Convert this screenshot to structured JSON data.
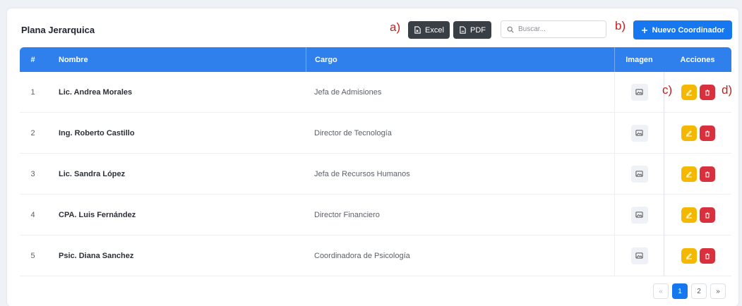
{
  "panel": {
    "title": "Plana Jerarquica"
  },
  "toolbar": {
    "excel_label": "Excel",
    "pdf_label": "PDF",
    "search_placeholder": "Buscar...",
    "new_label": "Nuevo Coordinador"
  },
  "annotations": {
    "a": "a)",
    "b": "b)",
    "c": "c)",
    "d": "d)"
  },
  "table": {
    "headers": {
      "num": "#",
      "name": "Nombre",
      "cargo": "Cargo",
      "image": "Imagen",
      "actions": "Acciones"
    },
    "rows": [
      {
        "num": "1",
        "name": "Lic. Andrea Morales",
        "cargo": "Jefa de Admisiones"
      },
      {
        "num": "2",
        "name": "Ing. Roberto Castillo",
        "cargo": "Director de Tecnología"
      },
      {
        "num": "3",
        "name": "Lic. Sandra López",
        "cargo": "Jefa de Recursos Humanos"
      },
      {
        "num": "4",
        "name": "CPA. Luis Fernández",
        "cargo": "Director Financiero"
      },
      {
        "num": "5",
        "name": "Psic. Diana Sanchez",
        "cargo": "Coordinadora de Psicología"
      }
    ]
  },
  "pagination": {
    "prev": "«",
    "pages": [
      "1",
      "2"
    ],
    "current": "1",
    "next": "»"
  },
  "colors": {
    "primary": "#1677ee",
    "header": "#2f80ed",
    "edit": "#f5b800",
    "delete": "#d9303e",
    "dark_button": "#3a3f45"
  },
  "icons": [
    "file-excel-icon",
    "file-pdf-icon",
    "search-icon",
    "plus-icon",
    "image-icon",
    "edit-icon",
    "trash-icon"
  ]
}
